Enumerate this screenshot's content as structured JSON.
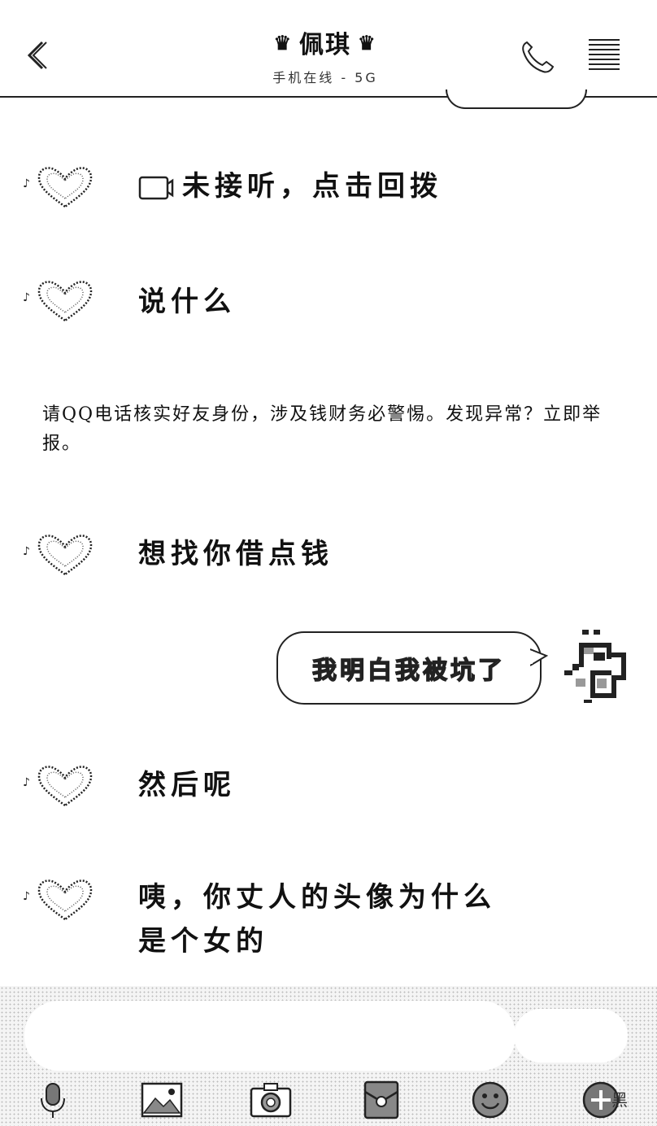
{
  "header": {
    "title": "佩琪",
    "subtitle": "手机在线 - 5G"
  },
  "messages": [
    {
      "id": "call",
      "text": "未接听，点击回拨"
    },
    {
      "id": "m1",
      "text": "说什么"
    },
    {
      "id": "m2",
      "text": "想找你借点钱"
    },
    {
      "id": "m3",
      "text": "然后呢"
    },
    {
      "id": "m4",
      "line1": "咦，你丈人的头像为什么",
      "line2": "是个女的"
    }
  ],
  "notice": "请QQ电话核实好友身份，涉及钱财务必警惕。发现异常？立即举报。",
  "my_message": "我明白我被坑了",
  "input": {
    "placeholder": "",
    "send_label": ""
  },
  "watermark": "黑",
  "icons": [
    "back-icon",
    "phone-icon",
    "menu-icon",
    "heart-avatar",
    "pixel-avatar",
    "voice-icon",
    "image-icon",
    "camera-icon",
    "redpacket-icon",
    "emoji-icon",
    "plus-icon"
  ]
}
